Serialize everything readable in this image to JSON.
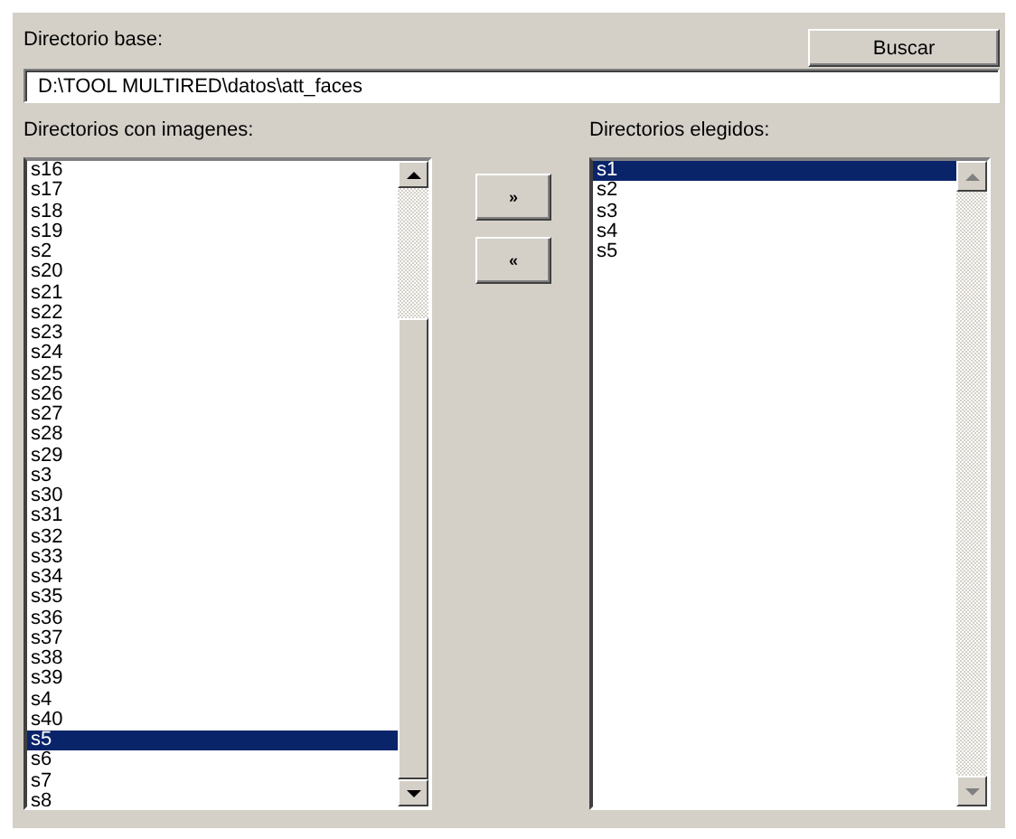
{
  "base_directory": {
    "label": "Directorio base:",
    "value": "D:\\TOOL MULTIRED\\datos\\att_faces"
  },
  "search_button": {
    "label": "Buscar"
  },
  "available_list": {
    "label": "Directorios con imagenes:",
    "items": [
      {
        "text": "s16",
        "selected": false
      },
      {
        "text": "s17",
        "selected": false
      },
      {
        "text": "s18",
        "selected": false
      },
      {
        "text": "s19",
        "selected": false
      },
      {
        "text": "s2",
        "selected": false
      },
      {
        "text": "s20",
        "selected": false
      },
      {
        "text": "s21",
        "selected": false
      },
      {
        "text": "s22",
        "selected": false
      },
      {
        "text": "s23",
        "selected": false
      },
      {
        "text": "s24",
        "selected": false
      },
      {
        "text": "s25",
        "selected": false
      },
      {
        "text": "s26",
        "selected": false
      },
      {
        "text": "s27",
        "selected": false
      },
      {
        "text": "s28",
        "selected": false
      },
      {
        "text": "s29",
        "selected": false
      },
      {
        "text": "s3",
        "selected": false
      },
      {
        "text": "s30",
        "selected": false
      },
      {
        "text": "s31",
        "selected": false
      },
      {
        "text": "s32",
        "selected": false
      },
      {
        "text": "s33",
        "selected": false
      },
      {
        "text": "s34",
        "selected": false
      },
      {
        "text": "s35",
        "selected": false
      },
      {
        "text": "s36",
        "selected": false
      },
      {
        "text": "s37",
        "selected": false
      },
      {
        "text": "s38",
        "selected": false
      },
      {
        "text": "s39",
        "selected": false
      },
      {
        "text": "s4",
        "selected": false
      },
      {
        "text": "s40",
        "selected": false
      },
      {
        "text": "s5",
        "selected": true
      },
      {
        "text": "s6",
        "selected": false
      },
      {
        "text": "s7",
        "selected": false
      },
      {
        "text": "s8",
        "selected": false
      }
    ]
  },
  "move_buttons": [
    {
      "label": "»"
    },
    {
      "label": "«"
    }
  ],
  "chosen_list": {
    "label": "Directorios elegidos:",
    "items": [
      {
        "text": "s1",
        "selected": true
      },
      {
        "text": "s2",
        "selected": false
      },
      {
        "text": "s3",
        "selected": false
      },
      {
        "text": "s4",
        "selected": false
      },
      {
        "text": "s5",
        "selected": false
      }
    ]
  }
}
